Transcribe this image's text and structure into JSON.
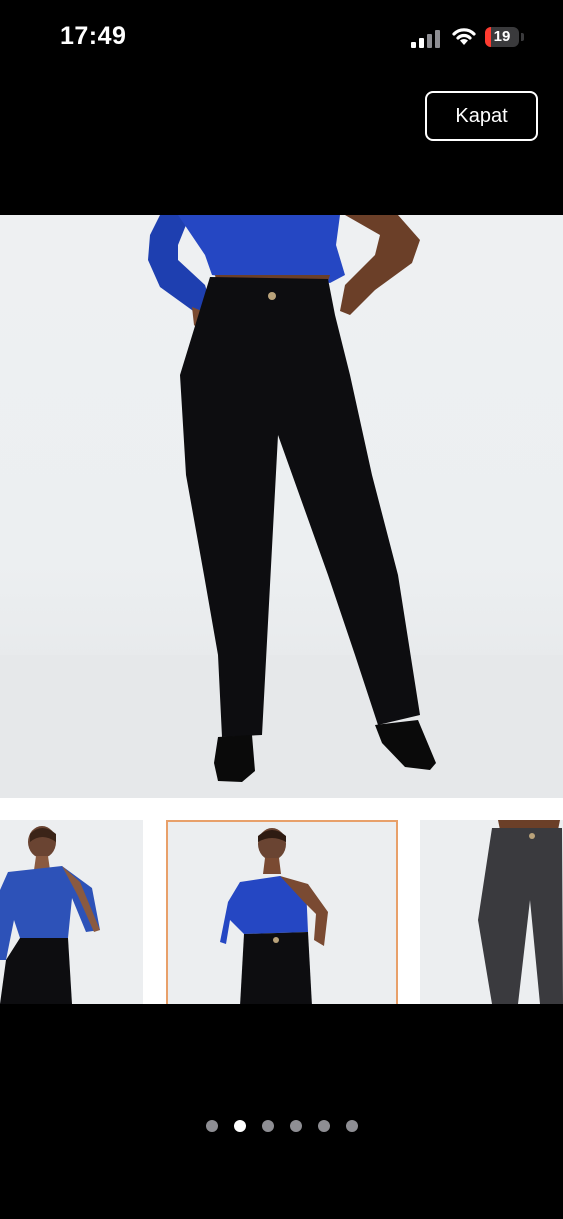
{
  "status_bar": {
    "time": "17:49",
    "battery_level": "19",
    "battery_color": "#ff3b30",
    "signal_icon": "cellular-signal-icon",
    "wifi_icon": "wifi-icon"
  },
  "close_button": {
    "label": "Kapat"
  },
  "gallery": {
    "main_image": "product-photo-black-flare-jeans-blue-top",
    "thumbnails": [
      {
        "name": "thumbnail-1",
        "selected": false
      },
      {
        "name": "thumbnail-2",
        "selected": true
      },
      {
        "name": "thumbnail-3",
        "selected": false
      }
    ],
    "selected_border_color": "#e8a06a",
    "page_count": 6,
    "active_page": 2
  }
}
